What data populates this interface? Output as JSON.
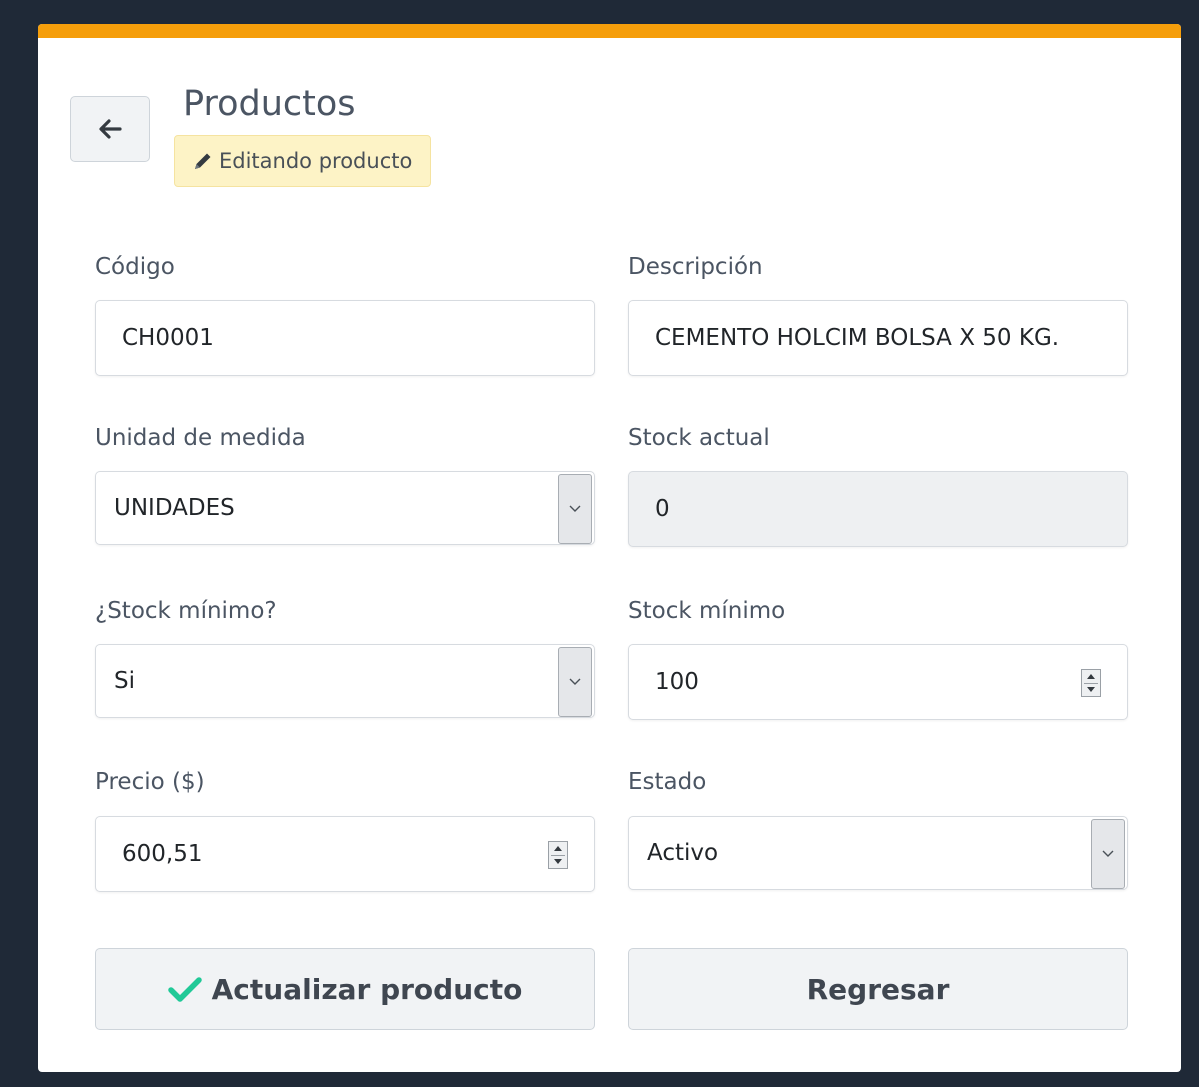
{
  "header": {
    "title": "Productos",
    "badge": "Editando producto"
  },
  "form": {
    "codigo": {
      "label": "Código",
      "value": "CH0001"
    },
    "descripcion": {
      "label": "Descripción",
      "value": "CEMENTO HOLCIM BOLSA X 50 KG."
    },
    "unidad": {
      "label": "Unidad de medida",
      "value": "UNIDADES"
    },
    "stock_actual": {
      "label": "Stock actual",
      "value": "0"
    },
    "stock_minimo_flag": {
      "label": "¿Stock mínimo?",
      "value": "Si"
    },
    "stock_minimo": {
      "label": "Stock mínimo",
      "value": "100"
    },
    "precio": {
      "label": "Precio ($)",
      "value": "600,51"
    },
    "estado": {
      "label": "Estado",
      "value": "Activo"
    }
  },
  "actions": {
    "update_label": "Actualizar producto",
    "back_label": "Regresar"
  },
  "colors": {
    "accent": "#f59e0b",
    "badge_bg": "#fdf3c6",
    "check": "#20c997"
  }
}
